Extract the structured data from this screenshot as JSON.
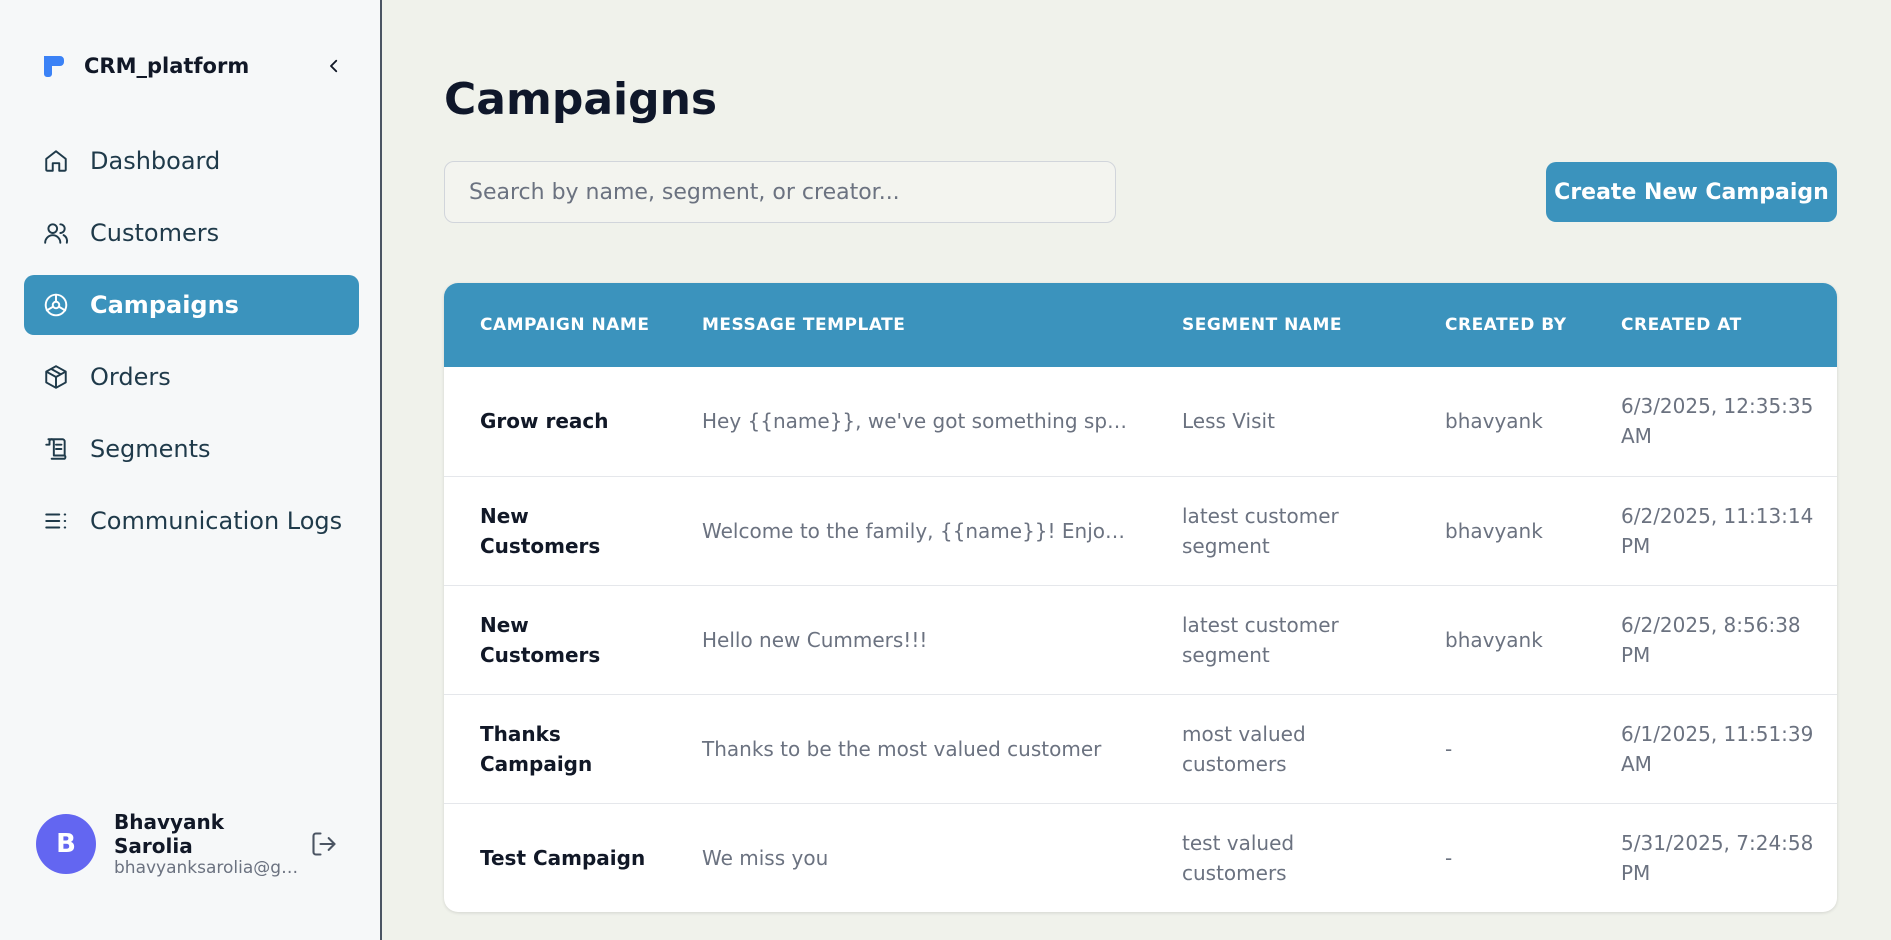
{
  "app": {
    "name": "CRM_platform"
  },
  "sidebar": {
    "items": [
      {
        "label": "Dashboard",
        "icon": "home-icon",
        "active": false
      },
      {
        "label": "Customers",
        "icon": "users-icon",
        "active": false
      },
      {
        "label": "Campaigns",
        "icon": "campaigns-icon",
        "active": true
      },
      {
        "label": "Orders",
        "icon": "package-icon",
        "active": false
      },
      {
        "label": "Segments",
        "icon": "scroll-icon",
        "active": false
      },
      {
        "label": "Communication Logs",
        "icon": "list-icon",
        "active": false
      }
    ],
    "user": {
      "initial": "B",
      "name": "Bhavyank Sarolia",
      "email": "bhavyanksarolia@gm..."
    }
  },
  "main": {
    "title": "Campaigns",
    "search": {
      "placeholder": "Search by name, segment, or creator...",
      "value": ""
    },
    "create_button": "Create New Campaign",
    "table": {
      "headers": [
        "CAMPAIGN NAME",
        "MESSAGE TEMPLATE",
        "SEGMENT NAME",
        "CREATED BY",
        "CREATED AT"
      ],
      "rows": [
        {
          "name": "Grow reach",
          "template": "Hey {{name}}, we've got something special...",
          "segment": "Less Visit",
          "created_by": "bhavyank",
          "created_at": "6/3/2025, 12:35:35 AM"
        },
        {
          "name": "New Customers",
          "template": "Welcome to the family, {{name}}! Enjoy {{t...",
          "segment": "latest customer segment",
          "created_by": "bhavyank",
          "created_at": "6/2/2025, 11:13:14 PM"
        },
        {
          "name": "New Customers",
          "template": "Hello new Cummers!!!",
          "segment": "latest customer segment",
          "created_by": "bhavyank",
          "created_at": "6/2/2025, 8:56:38 PM"
        },
        {
          "name": "Thanks Campaign",
          "template": "Thanks to be the most valued customer",
          "segment": "most valued customers",
          "created_by": "-",
          "created_at": "6/1/2025, 11:51:39 AM"
        },
        {
          "name": "Test Campaign",
          "template": "We miss you",
          "segment": "test valued customers",
          "created_by": "-",
          "created_at": "5/31/2025, 7:24:58 PM"
        }
      ]
    }
  },
  "colors": {
    "accent": "#3b93bd",
    "avatar": "#6366f1",
    "logo": "#3b82f6"
  }
}
